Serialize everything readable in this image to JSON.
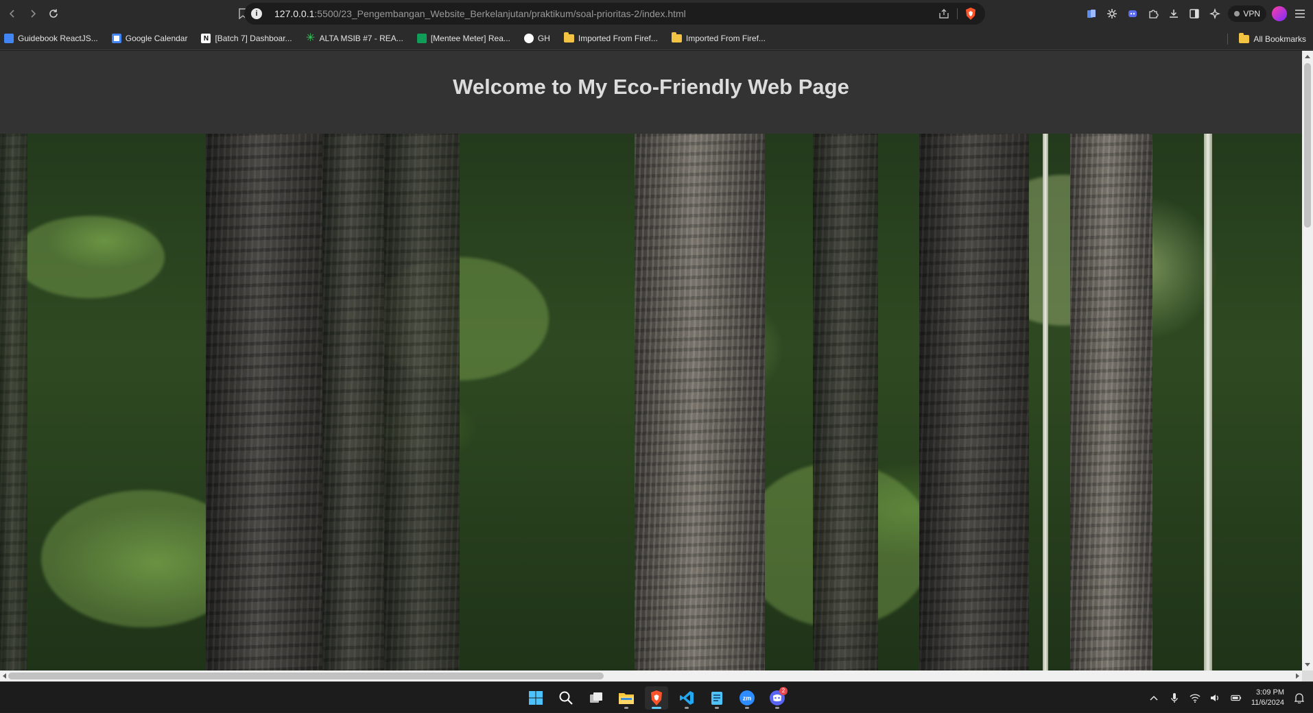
{
  "browser": {
    "url_host": "127.0.0.1",
    "url_rest": ":5500/23_Pengembangan_Website_Berkelanjutan/praktikum/soal-prioritas-2/index.html",
    "vpn_label": "VPN"
  },
  "bookmarks": [
    {
      "label": "Guidebook ReactJS...",
      "icon": "doc-icon",
      "color": "#4285f4"
    },
    {
      "label": "Google Calendar",
      "icon": "calendar-icon",
      "color": "#4285f4"
    },
    {
      "label": "[Batch 7] Dashboar...",
      "icon": "notion-icon",
      "color": "#ffffff"
    },
    {
      "label": "ALTA MSIB #7 - REA...",
      "icon": "asterisk-icon",
      "color": "#35c759"
    },
    {
      "label": "[Mentee Meter] Rea...",
      "icon": "sheets-icon",
      "color": "#0f9d58"
    },
    {
      "label": "GH",
      "icon": "github-icon",
      "color": "#ffffff"
    },
    {
      "label": "Imported From Firef...",
      "icon": "folder-icon",
      "color": "#f3c443"
    },
    {
      "label": "Imported From Firef...",
      "icon": "folder-icon",
      "color": "#f3c443"
    }
  ],
  "bookmarks_right": {
    "label": "All Bookmarks",
    "icon": "folder-icon"
  },
  "page": {
    "title": "Welcome to My Eco-Friendly Web Page",
    "header_bg": "#333333",
    "hero_image": "forest-image"
  },
  "taskbar": {
    "apps": [
      {
        "name": "windows-start-icon",
        "active": false
      },
      {
        "name": "search-icon",
        "active": false
      },
      {
        "name": "task-view-icon",
        "active": false
      },
      {
        "name": "file-explorer-icon",
        "active": false
      },
      {
        "name": "brave-browser-icon",
        "active": true
      },
      {
        "name": "vscode-icon",
        "active": false
      },
      {
        "name": "notepad-icon",
        "active": false
      },
      {
        "name": "zoom-icon",
        "active": false
      },
      {
        "name": "discord-icon",
        "active": false,
        "badge": "2"
      }
    ],
    "time": "3:09 PM",
    "date": "11/6/2024"
  }
}
